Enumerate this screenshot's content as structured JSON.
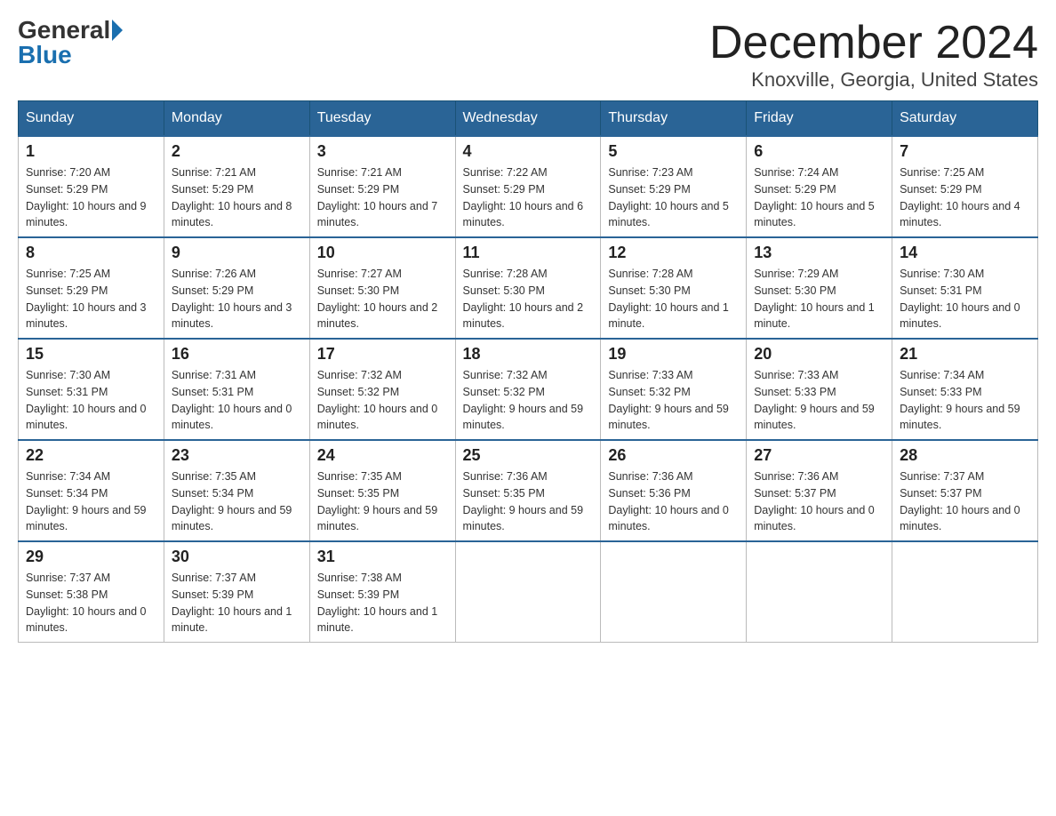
{
  "header": {
    "logo_general": "General",
    "logo_blue": "Blue",
    "title": "December 2024",
    "subtitle": "Knoxville, Georgia, United States"
  },
  "days_of_week": [
    "Sunday",
    "Monday",
    "Tuesday",
    "Wednesday",
    "Thursday",
    "Friday",
    "Saturday"
  ],
  "weeks": [
    [
      {
        "day": "1",
        "sunrise": "7:20 AM",
        "sunset": "5:29 PM",
        "daylight": "10 hours and 9 minutes."
      },
      {
        "day": "2",
        "sunrise": "7:21 AM",
        "sunset": "5:29 PM",
        "daylight": "10 hours and 8 minutes."
      },
      {
        "day": "3",
        "sunrise": "7:21 AM",
        "sunset": "5:29 PM",
        "daylight": "10 hours and 7 minutes."
      },
      {
        "day": "4",
        "sunrise": "7:22 AM",
        "sunset": "5:29 PM",
        "daylight": "10 hours and 6 minutes."
      },
      {
        "day": "5",
        "sunrise": "7:23 AM",
        "sunset": "5:29 PM",
        "daylight": "10 hours and 5 minutes."
      },
      {
        "day": "6",
        "sunrise": "7:24 AM",
        "sunset": "5:29 PM",
        "daylight": "10 hours and 5 minutes."
      },
      {
        "day": "7",
        "sunrise": "7:25 AM",
        "sunset": "5:29 PM",
        "daylight": "10 hours and 4 minutes."
      }
    ],
    [
      {
        "day": "8",
        "sunrise": "7:25 AM",
        "sunset": "5:29 PM",
        "daylight": "10 hours and 3 minutes."
      },
      {
        "day": "9",
        "sunrise": "7:26 AM",
        "sunset": "5:29 PM",
        "daylight": "10 hours and 3 minutes."
      },
      {
        "day": "10",
        "sunrise": "7:27 AM",
        "sunset": "5:30 PM",
        "daylight": "10 hours and 2 minutes."
      },
      {
        "day": "11",
        "sunrise": "7:28 AM",
        "sunset": "5:30 PM",
        "daylight": "10 hours and 2 minutes."
      },
      {
        "day": "12",
        "sunrise": "7:28 AM",
        "sunset": "5:30 PM",
        "daylight": "10 hours and 1 minute."
      },
      {
        "day": "13",
        "sunrise": "7:29 AM",
        "sunset": "5:30 PM",
        "daylight": "10 hours and 1 minute."
      },
      {
        "day": "14",
        "sunrise": "7:30 AM",
        "sunset": "5:31 PM",
        "daylight": "10 hours and 0 minutes."
      }
    ],
    [
      {
        "day": "15",
        "sunrise": "7:30 AM",
        "sunset": "5:31 PM",
        "daylight": "10 hours and 0 minutes."
      },
      {
        "day": "16",
        "sunrise": "7:31 AM",
        "sunset": "5:31 PM",
        "daylight": "10 hours and 0 minutes."
      },
      {
        "day": "17",
        "sunrise": "7:32 AM",
        "sunset": "5:32 PM",
        "daylight": "10 hours and 0 minutes."
      },
      {
        "day": "18",
        "sunrise": "7:32 AM",
        "sunset": "5:32 PM",
        "daylight": "9 hours and 59 minutes."
      },
      {
        "day": "19",
        "sunrise": "7:33 AM",
        "sunset": "5:32 PM",
        "daylight": "9 hours and 59 minutes."
      },
      {
        "day": "20",
        "sunrise": "7:33 AM",
        "sunset": "5:33 PM",
        "daylight": "9 hours and 59 minutes."
      },
      {
        "day": "21",
        "sunrise": "7:34 AM",
        "sunset": "5:33 PM",
        "daylight": "9 hours and 59 minutes."
      }
    ],
    [
      {
        "day": "22",
        "sunrise": "7:34 AM",
        "sunset": "5:34 PM",
        "daylight": "9 hours and 59 minutes."
      },
      {
        "day": "23",
        "sunrise": "7:35 AM",
        "sunset": "5:34 PM",
        "daylight": "9 hours and 59 minutes."
      },
      {
        "day": "24",
        "sunrise": "7:35 AM",
        "sunset": "5:35 PM",
        "daylight": "9 hours and 59 minutes."
      },
      {
        "day": "25",
        "sunrise": "7:36 AM",
        "sunset": "5:35 PM",
        "daylight": "9 hours and 59 minutes."
      },
      {
        "day": "26",
        "sunrise": "7:36 AM",
        "sunset": "5:36 PM",
        "daylight": "10 hours and 0 minutes."
      },
      {
        "day": "27",
        "sunrise": "7:36 AM",
        "sunset": "5:37 PM",
        "daylight": "10 hours and 0 minutes."
      },
      {
        "day": "28",
        "sunrise": "7:37 AM",
        "sunset": "5:37 PM",
        "daylight": "10 hours and 0 minutes."
      }
    ],
    [
      {
        "day": "29",
        "sunrise": "7:37 AM",
        "sunset": "5:38 PM",
        "daylight": "10 hours and 0 minutes."
      },
      {
        "day": "30",
        "sunrise": "7:37 AM",
        "sunset": "5:39 PM",
        "daylight": "10 hours and 1 minute."
      },
      {
        "day": "31",
        "sunrise": "7:38 AM",
        "sunset": "5:39 PM",
        "daylight": "10 hours and 1 minute."
      },
      null,
      null,
      null,
      null
    ]
  ]
}
